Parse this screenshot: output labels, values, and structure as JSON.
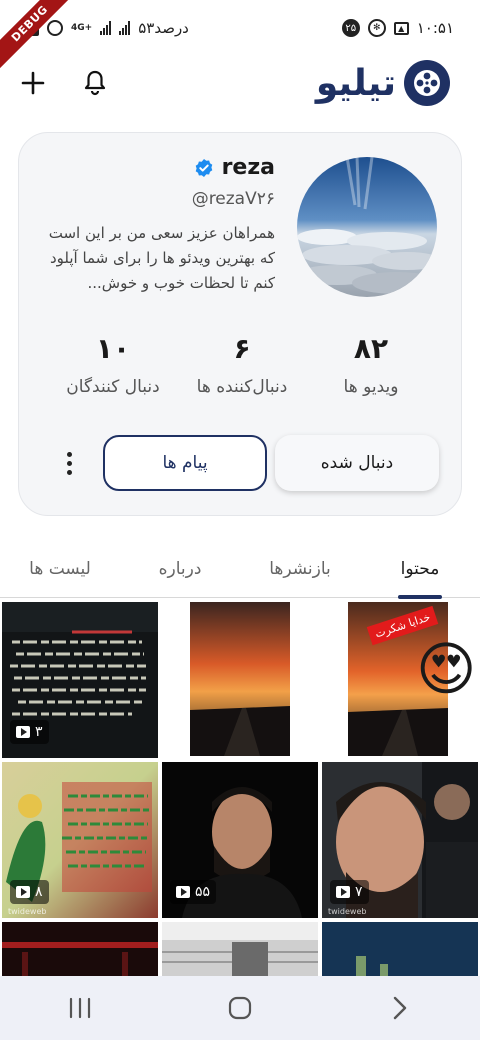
{
  "status_bar": {
    "time": "۱۰:۵۱",
    "notification_count": "۲۵",
    "battery_text": "۵۳درصد",
    "network_label": "4G+"
  },
  "debug_label": "DEBUG",
  "app_bar": {
    "brand_name": "تیلیو",
    "brand_color": "#1f3163"
  },
  "profile": {
    "name": "reza",
    "handle": "@rezaV۲۶",
    "bio": "همراهان عزیز سعی من بر این است که بهترین ویدئو ها را برای شما آپلود کنم تا لحظات خوب و خوش...",
    "verified": true,
    "stats": [
      {
        "value": "۸۲",
        "label": "ویدیو ها"
      },
      {
        "value": "۶",
        "label": "دنبال‌کننده ها"
      },
      {
        "value": "۱۰",
        "label": "دنبال کنندگان"
      }
    ],
    "follow_label": "دنبال شده",
    "message_label": "پیام ها"
  },
  "tabs": [
    {
      "label": "محتوا",
      "active": true
    },
    {
      "label": "بازنشرها",
      "active": false
    },
    {
      "label": "درباره",
      "active": false
    },
    {
      "label": "لیست ها",
      "active": false
    }
  ],
  "videos": [
    {
      "views": "",
      "overlay_text": "خدایا شکرت",
      "emoji": "😍"
    },
    {
      "views": "",
      "overlay_text": "",
      "emoji": ""
    },
    {
      "views": "۳",
      "overlay_text": "",
      "emoji": ""
    },
    {
      "views": "۷",
      "overlay_text": "",
      "emoji": ""
    },
    {
      "views": "۵۵",
      "overlay_text": "",
      "emoji": ""
    },
    {
      "views": "۸",
      "overlay_text": "",
      "emoji": ""
    }
  ],
  "watermark": "twideweb"
}
